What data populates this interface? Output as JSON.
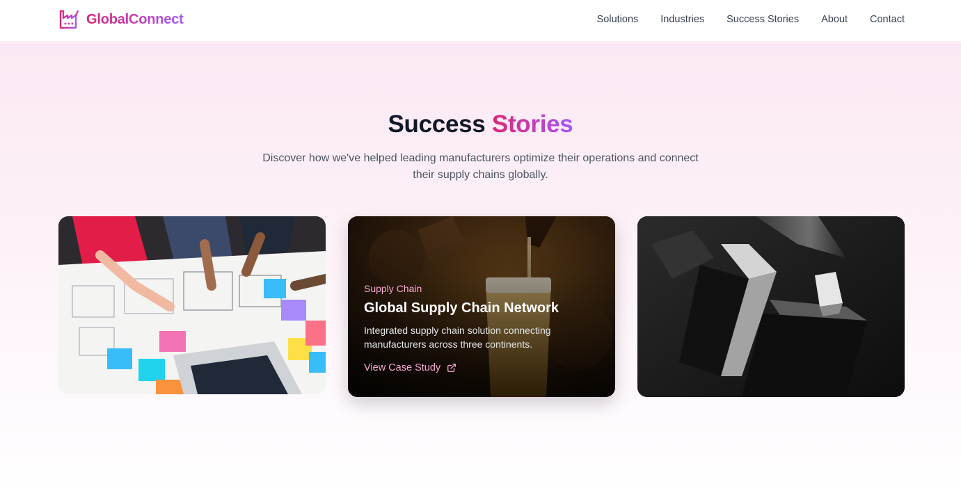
{
  "brand": {
    "name": "GlobalConnect",
    "icon": "factory-icon",
    "gradient": [
      "#db2777",
      "#a855f7"
    ]
  },
  "nav": {
    "items": [
      "Solutions",
      "Industries",
      "Success Stories",
      "About",
      "Contact"
    ]
  },
  "hero": {
    "title_plain": "Success",
    "title_accent": "Stories",
    "subtitle": "Discover how we've helped leading manufacturers optimize their operations and connect their supply chains globally."
  },
  "cards": [
    {
      "image": "team-planning-sticky-notes-photo"
    },
    {
      "image": "beer-glass-pour-photo",
      "tag": "Supply Chain",
      "title": "Global Supply Chain Network",
      "description": "Integrated supply chain solution connecting manufacturers across three continents.",
      "link_label": "View Case Study",
      "link_icon": "external-link-icon"
    },
    {
      "image": "abstract-monochrome-blocks-photo"
    }
  ]
}
